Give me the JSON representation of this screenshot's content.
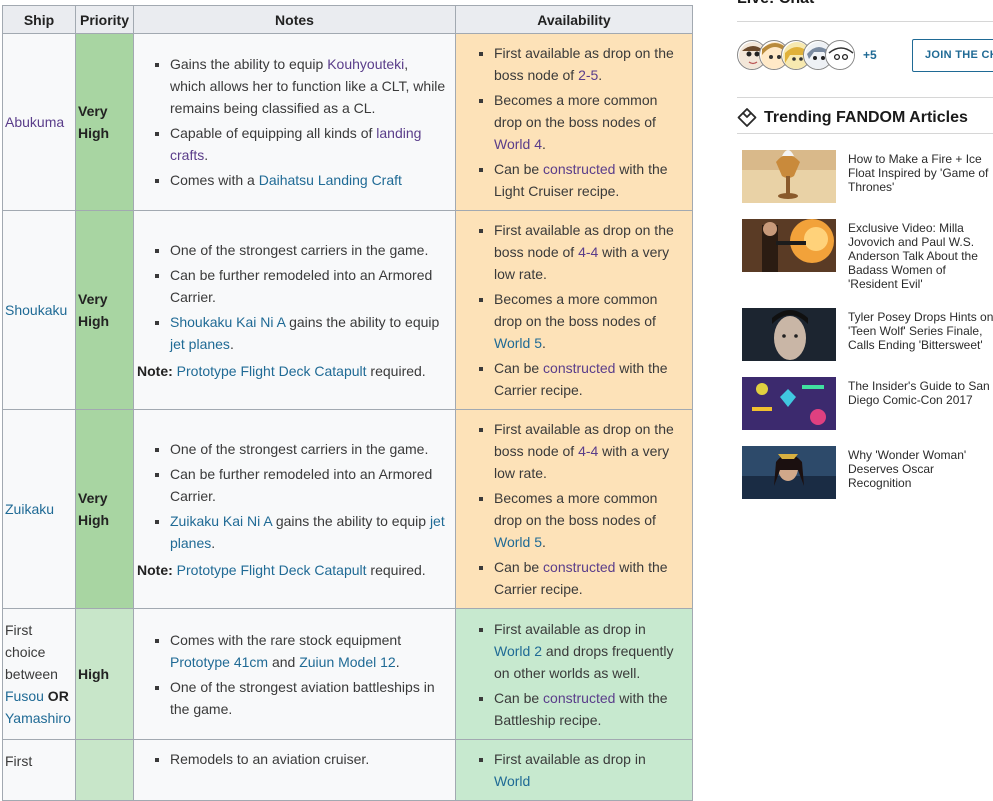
{
  "table": {
    "headers": [
      "Ship",
      "Priority",
      "Notes",
      "Availability"
    ],
    "rows": [
      {
        "ship": "Abukuma",
        "priority": "Very High",
        "notes": [
          {
            "pre": "Gains the ability to equip ",
            "link": "Kouhyouteki",
            "post": ", which allows her to function like a CLT, while remains being classified as a CL."
          },
          {
            "pre": "Capable of equipping all kinds of ",
            "link": "landing crafts",
            "post": "."
          },
          {
            "pre": "Comes with a ",
            "link": "Daihatsu Landing Craft",
            "post": ""
          }
        ],
        "availability": [
          {
            "pre": "First available as drop on the boss node of ",
            "link": "2-5",
            "post": "."
          },
          {
            "pre": "Becomes a more common drop on the boss nodes of ",
            "link": "World 4",
            "post": "."
          },
          {
            "pre": "Can be ",
            "link": "constructed",
            "post": " with the Light Cruiser recipe."
          }
        ]
      },
      {
        "ship": "Shoukaku",
        "priority": "Very High",
        "notes": [
          {
            "pre": "One of the strongest carriers in the game.",
            "link": "",
            "post": ""
          },
          {
            "pre": "Can be further remodeled into an Armored Carrier.",
            "link": "",
            "post": ""
          },
          {
            "pre": "",
            "link": "Shoukaku Kai Ni A",
            "post": " gains the ability to equip ",
            "link2": "jet planes",
            "post2": "."
          }
        ],
        "note": {
          "label": "Note:",
          "link": "Prototype Flight Deck Catapult",
          "post": " required."
        },
        "availability": [
          {
            "pre": "First available as drop on the boss node of ",
            "link": "4-4",
            "post": " with a very low rate."
          },
          {
            "pre": "Becomes a more common drop on the boss nodes of ",
            "link": "World 5",
            "post": "."
          },
          {
            "pre": "Can be ",
            "link": "constructed",
            "post": " with the Carrier recipe."
          }
        ]
      },
      {
        "ship": "Zuikaku",
        "priority": "Very High",
        "notes": [
          {
            "pre": "One of the strongest carriers in the game.",
            "link": "",
            "post": ""
          },
          {
            "pre": "Can be further remodeled into an Armored Carrier.",
            "link": "",
            "post": ""
          },
          {
            "pre": "",
            "link": "Zuikaku Kai Ni A",
            "post": " gains the ability to equip ",
            "link2": "jet planes",
            "post2": "."
          }
        ],
        "note": {
          "label": "Note:",
          "link": "Prototype Flight Deck Catapult",
          "post": " required."
        },
        "availability": [
          {
            "pre": "First available as drop on the boss node of ",
            "link": "4-4",
            "post": " with a very low rate."
          },
          {
            "pre": "Becomes a more common drop on the boss nodes of ",
            "link": "World 5",
            "post": "."
          },
          {
            "pre": "Can be ",
            "link": "constructed",
            "post": " with the Carrier recipe."
          }
        ]
      },
      {
        "ship_pre": "First choice between ",
        "ship_link1": "Fusou",
        "ship_or": " OR ",
        "ship_link2": "Yamashiro",
        "priority": "High",
        "notes": [
          {
            "pre": "Comes with the rare stock equipment ",
            "link": "Prototype 41cm",
            "post": " and ",
            "link2": "Zuiun Model 12",
            "post2": "."
          },
          {
            "pre": "One of the strongest aviation battleships in the game.",
            "link": "",
            "post": ""
          }
        ],
        "availability": [
          {
            "pre": "First available as drop in ",
            "link": "World 2",
            "post": " and drops frequently on other worlds as well."
          },
          {
            "pre": "Can be ",
            "link": "constructed",
            "post": " with the Battleship recipe."
          }
        ]
      },
      {
        "ship": "First",
        "notes": [
          {
            "pre": "Remodels to an aviation cruiser.",
            "link": "",
            "post": ""
          }
        ],
        "availability": [
          {
            "pre": "First available as drop in ",
            "link": "World",
            "post": ""
          }
        ]
      }
    ]
  },
  "rail": {
    "live_chat_title": "Live! Chat",
    "plus_count": "+5",
    "join_label": "JOIN THE CHAT",
    "trending_title": "Trending FANDOM Articles",
    "articles": [
      "How to Make a Fire + Ice Float Inspired by 'Game of Thrones'",
      "Exclusive Video: Milla Jovovich and Paul W.S. Anderson Talk About the Badass Women of 'Resident Evil'",
      "Tyler Posey Drops Hints on 'Teen Wolf' Series Finale, Calls Ending 'Bittersweet'",
      "The Insider's Guide to San Diego Comic-Con 2017",
      "Why 'Wonder Woman' Deserves Oscar Recognition"
    ]
  },
  "colors": {
    "link": "#1f6a95",
    "visited": "#5a3d8a",
    "very_high": "#a8d5a2",
    "high": "#c8e6c9",
    "avail_orange": "#fde2b8",
    "avail_green": "#c7e9cf"
  }
}
